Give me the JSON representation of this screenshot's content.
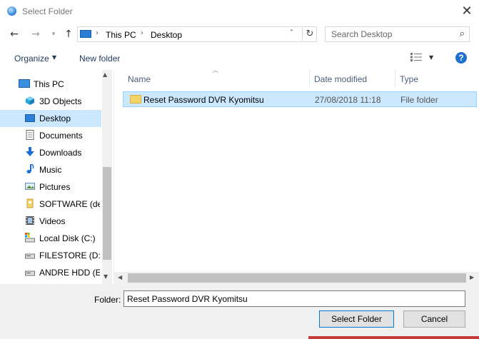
{
  "window": {
    "title": "Select Folder"
  },
  "nav": {
    "back_icon": "arrow-left-icon",
    "forward_icon": "arrow-right-icon",
    "recent_icon": "chevron-down-icon",
    "up_icon": "arrow-up-icon"
  },
  "address": {
    "crumbs": [
      "This PC",
      "Desktop"
    ],
    "separator": "›",
    "dropdown": "˅",
    "refresh": "↻"
  },
  "search": {
    "placeholder": "Search Desktop",
    "icon": "⌕"
  },
  "toolbar": {
    "organize": "Organize",
    "new_folder": "New folder",
    "help": "?"
  },
  "sidebar": {
    "items": [
      {
        "label": "This PC",
        "icon": "computer-icon"
      },
      {
        "label": "3D Objects",
        "icon": "cube-icon"
      },
      {
        "label": "Desktop",
        "icon": "desktop-icon",
        "selected": true
      },
      {
        "label": "Documents",
        "icon": "document-icon"
      },
      {
        "label": "Downloads",
        "icon": "download-icon"
      },
      {
        "label": "Music",
        "icon": "music-icon"
      },
      {
        "label": "Pictures",
        "icon": "pictures-icon"
      },
      {
        "label": "SOFTWARE (des",
        "icon": "folder-icon"
      },
      {
        "label": "Videos",
        "icon": "video-icon"
      },
      {
        "label": "Local Disk (C:)",
        "icon": "drive-icon"
      },
      {
        "label": "FILESTORE (D:)",
        "icon": "drive-icon"
      },
      {
        "label": "ANDRE HDD (E:)",
        "icon": "drive-icon"
      }
    ]
  },
  "columns": {
    "name": "Name",
    "date": "Date modified",
    "type": "Type"
  },
  "files": [
    {
      "name": "Reset Password DVR Kyomitsu",
      "date": "27/08/2018 11:18",
      "type": "File folder"
    }
  ],
  "footer": {
    "folder_label": "Folder:",
    "folder_value": "Reset Password DVR Kyomitsu",
    "select_button": "Select Folder",
    "cancel_button": "Cancel"
  },
  "colors": {
    "accent": "#0078d7",
    "selection": "#cce8ff",
    "link": "#1e395b"
  }
}
